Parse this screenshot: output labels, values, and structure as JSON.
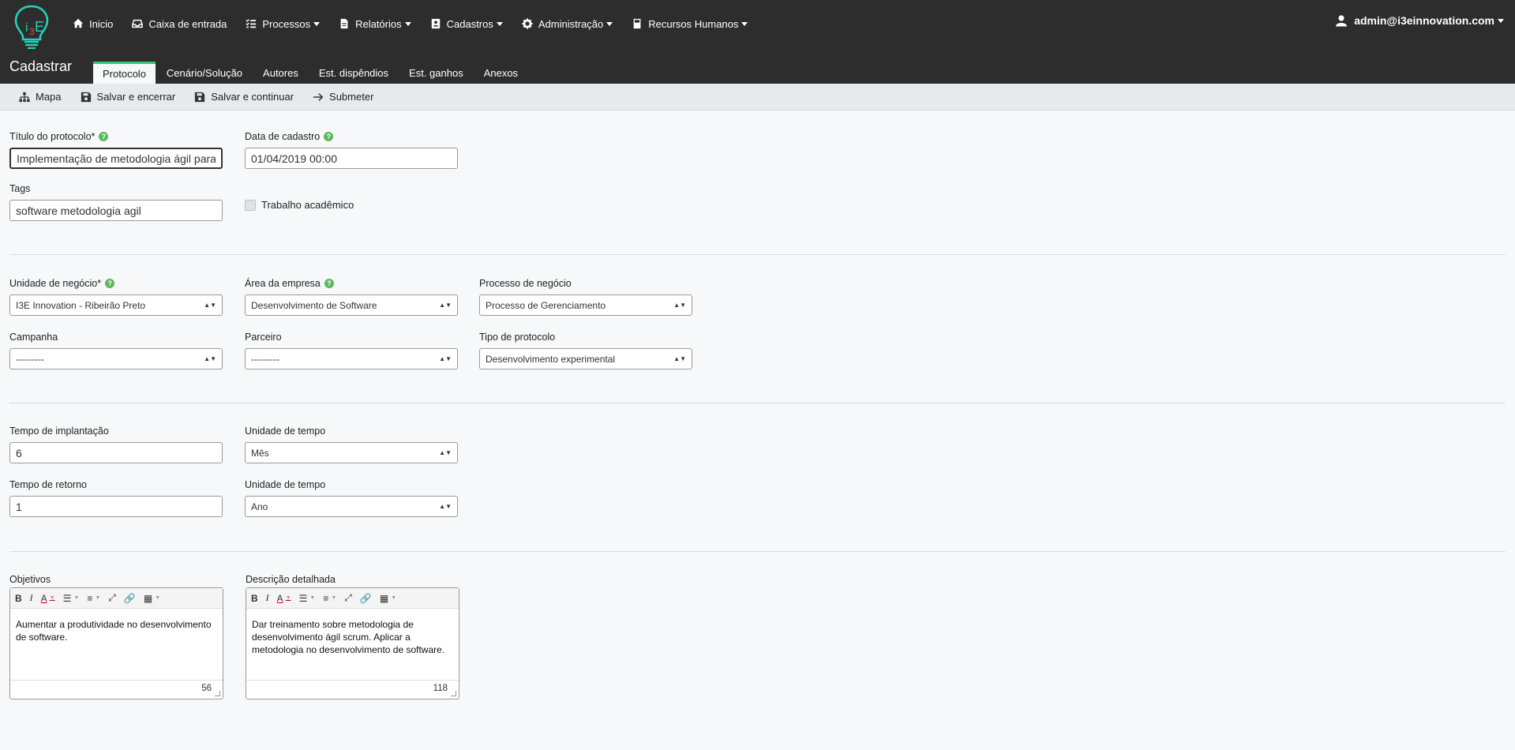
{
  "brand": {
    "logo_text": "i3E",
    "accent": "#2ecc71"
  },
  "nav": [
    {
      "label": "Inicio",
      "icon": "home-icon",
      "dropdown": false
    },
    {
      "label": "Caixa de entrada",
      "icon": "inbox-icon",
      "dropdown": false
    },
    {
      "label": "Processos",
      "icon": "tasks-icon",
      "dropdown": true
    },
    {
      "label": "Relatórios",
      "icon": "file-icon",
      "dropdown": true
    },
    {
      "label": "Cadastros",
      "icon": "id-card-icon",
      "dropdown": true
    },
    {
      "label": "Administração",
      "icon": "gear-icon",
      "dropdown": true
    },
    {
      "label": "Recursos Humanos",
      "icon": "book-icon",
      "dropdown": true
    }
  ],
  "user": {
    "email": "admin@i3einnovation.com"
  },
  "page": {
    "title": "Cadastrar"
  },
  "tabs": [
    "Protocolo",
    "Cenário/Solução",
    "Autores",
    "Est. dispêndios",
    "Est. ganhos",
    "Anexos"
  ],
  "toolbar": {
    "mapa": "Mapa",
    "salvar_encerrar": "Salvar e encerrar",
    "salvar_continuar": "Salvar e continuar",
    "submeter": "Submeter"
  },
  "form": {
    "titulo": {
      "label": "Título do protocolo*",
      "value": "Implementação de metodologia ágil para"
    },
    "data": {
      "label": "Data de cadastro",
      "value": "01/04/2019 00:00"
    },
    "tags": {
      "label": "Tags",
      "value": "software metodologia agil"
    },
    "academico": {
      "label": "Trabalho acadêmico"
    },
    "unidade": {
      "label": "Unidade de negócio*",
      "value": "I3E Innovation - Ribeirão Preto"
    },
    "area": {
      "label": "Área da empresa",
      "value": "Desenvolvimento de Software"
    },
    "processo": {
      "label": "Processo de negócio",
      "value": "Processo de Gerenciamento"
    },
    "campanha": {
      "label": "Campanha",
      "value": "---------"
    },
    "parceiro": {
      "label": "Parceiro",
      "value": "---------"
    },
    "tipo": {
      "label": "Tipo de protocolo",
      "value": "Desenvolvimento experimental"
    },
    "tempo_impl": {
      "label": "Tempo de implantação",
      "value": "6"
    },
    "unidade_tempo1": {
      "label": "Unidade de tempo",
      "value": "Mês"
    },
    "tempo_ret": {
      "label": "Tempo de retorno",
      "value": "1"
    },
    "unidade_tempo2": {
      "label": "Unidade de tempo",
      "value": "Ano"
    },
    "objetivos": {
      "label": "Objetivos",
      "text": "Aumentar a produtividade no desenvolvimento de software.",
      "count": "56"
    },
    "descricao": {
      "label": "Descrição detalhada",
      "text": "Dar treinamento sobre metodologia de desenvolvimento ágil scrum. Aplicar a metodologia no desenvolvimento de software.",
      "count": "118"
    }
  }
}
